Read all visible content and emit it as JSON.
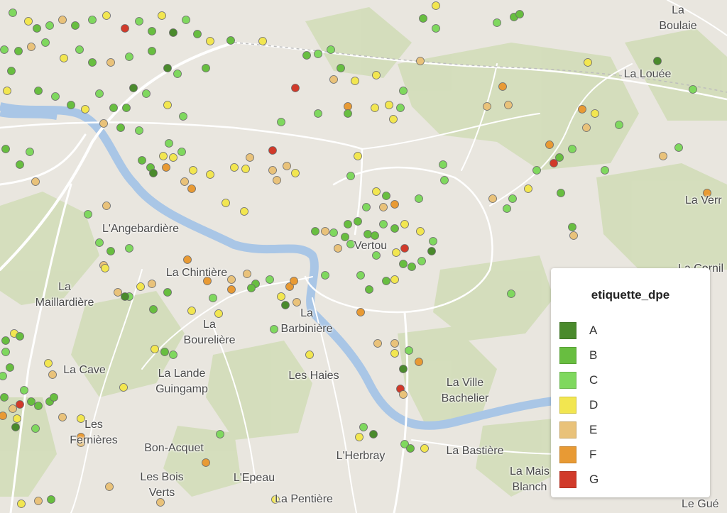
{
  "map": {
    "legend_title": "etiquette_dpe",
    "legend": [
      {
        "label": "A",
        "color": "#4a8a2c"
      },
      {
        "label": "B",
        "color": "#68be40"
      },
      {
        "label": "C",
        "color": "#7fd85e"
      },
      {
        "label": "D",
        "color": "#f2e650"
      },
      {
        "label": "E",
        "color": "#e9c27a"
      },
      {
        "label": "F",
        "color": "#e89a34"
      },
      {
        "label": "G",
        "color": "#d13a2a"
      }
    ],
    "places": {
      "la_boulaie": "La Boulaie",
      "la_louee": "La Louée",
      "la_verr": "La Verr",
      "la_cornil": "La Cornil",
      "langebardiere": "L'Angebardière",
      "vertou": "Vertou",
      "la_chintiere": "La Chintière",
      "la_maillardiere": "La\nMaillardière",
      "la_bouteliere": "La\nBourelière",
      "la_barbiniere": "La\nBarbinière",
      "la_cave": "La Cave",
      "la_lande_guingamp": "La Lande\nGuingamp",
      "les_haies": "Les Haies",
      "la_ville_bachelier": "La Ville\nBachelier",
      "les_fernieres": "Les\nFernières",
      "bon_acquet": "Bon-Acquet",
      "lherbray": "L'Herbray",
      "la_bastiere": "La Bastière",
      "la_maison_blanche": "La Mais\nBlanch",
      "les_bois_verts": "Les Bois\nVerts",
      "lepeau": "L'Epeau",
      "la_pentiere": "La Pentière",
      "le_gue": "Le Gué"
    }
  }
}
